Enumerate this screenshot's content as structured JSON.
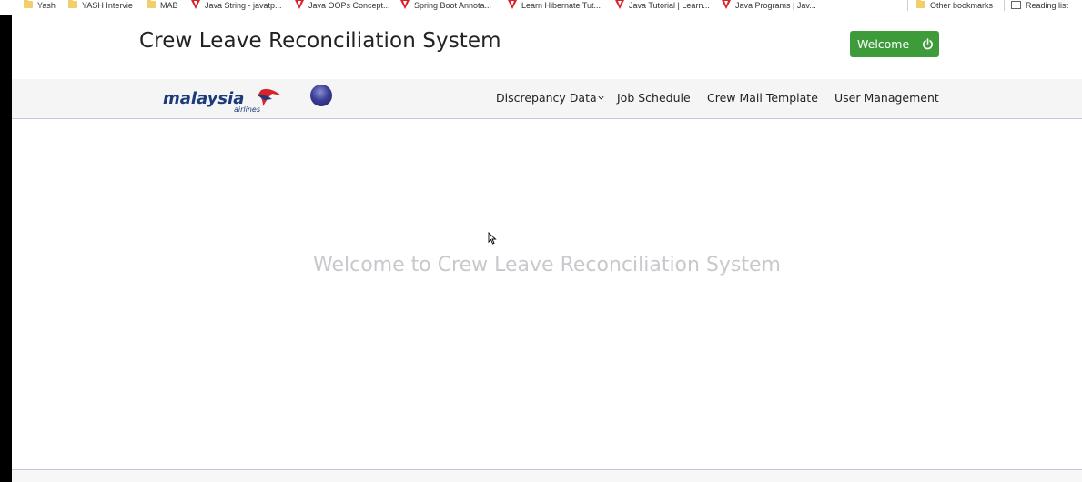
{
  "bookmarks_bar": {
    "items": [
      {
        "label": "Yash",
        "icon": "folder-icon"
      },
      {
        "label": "YASH Intervie",
        "icon": "folder-icon"
      },
      {
        "label": "MAB",
        "icon": "folder-icon"
      },
      {
        "label": "Java String - javatp...",
        "icon": "javatpoint-icon"
      },
      {
        "label": "Java OOPs Concept...",
        "icon": "javatpoint-icon"
      },
      {
        "label": "Spring Boot Annota...",
        "icon": "javatpoint-icon"
      },
      {
        "label": "Learn Hibernate Tut...",
        "icon": "javatpoint-icon"
      },
      {
        "label": "Java Tutorial | Learn...",
        "icon": "javatpoint-icon"
      },
      {
        "label": "Java Programs | Jav...",
        "icon": "javatpoint-icon"
      }
    ],
    "other_bookmarks": "Other bookmarks",
    "reading_list": "Reading list"
  },
  "header": {
    "title": "Crew Leave Reconciliation System",
    "welcome_button": "Welcome",
    "welcome_icon": "power-icon",
    "accent_color": "#3e9b3a"
  },
  "navbar": {
    "logo": "malaysia airlines",
    "partner_logo": "oneworld",
    "items": [
      {
        "label": "Discrepancy Data",
        "has_dropdown": true
      },
      {
        "label": "Job Schedule"
      },
      {
        "label": "Crew Mail Template"
      },
      {
        "label": "User Management"
      }
    ]
  },
  "main": {
    "welcome_message": "Welcome to Crew Leave Reconciliation System"
  }
}
